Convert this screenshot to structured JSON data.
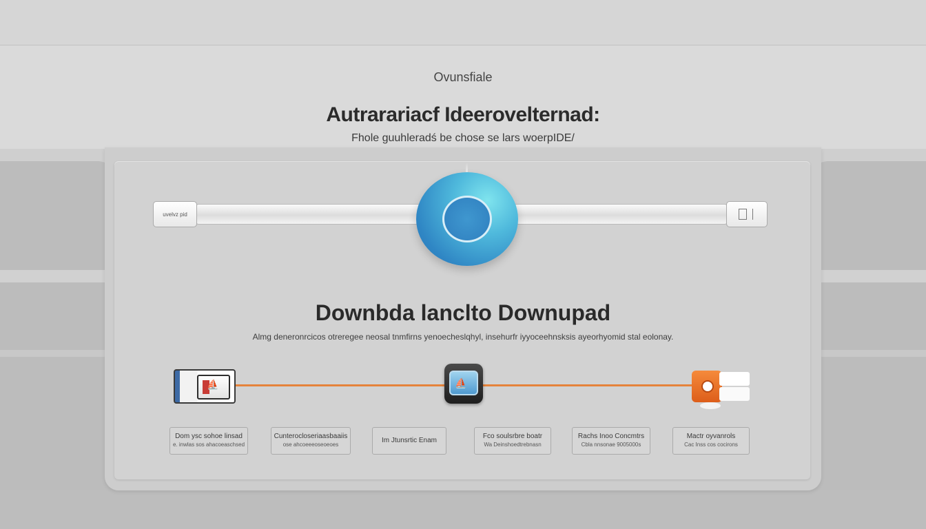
{
  "header": {
    "overline": "Ovunsfiale",
    "title": "Autrarariacf Ideerovelternad:",
    "subtitle": "Fhole guuhleradś be chose se lars woerpIDE/"
  },
  "slider": {
    "left_label": "uvelvz pid",
    "knob_icon": "circle-ring-icon"
  },
  "section": {
    "heading": "Downbda lanclto Downupad",
    "description": "Almg deneronrcicos otreregee neosal tnmfirns yenoecheslqhyl, insehurfr iyyoceehnsksis ayeorhyomid stal eolonay."
  },
  "timeline": {
    "line_color": "#e5823a",
    "nodes": [
      {
        "name": "document-gallery-node",
        "icon": "sailboat-icon"
      },
      {
        "name": "tablet-device-node",
        "icon": "tablet-screen-icon",
        "glyph": "⛵"
      },
      {
        "name": "orange-app-node",
        "icon": "orange-record-icon"
      }
    ]
  },
  "buttons": [
    {
      "line1": "Dom ysc sohoe linsad",
      "line2": "e. inwlas sos ahacoeaschsed"
    },
    {
      "line1": "Cunterocloseriaasbaaiis",
      "line2": "ose ahcoeeeoseoeoes"
    },
    {
      "line1": "Im Jtunsrtic Enam",
      "line2": ""
    },
    {
      "line1": "Fco soulsrbre boatr",
      "line2": "Wa Deinshoedtrebnasn"
    },
    {
      "line1": "Rachs Inoo Concmtrs",
      "line2": "Cbla nnsonae 9005000s"
    },
    {
      "line1": "Mactr oyvanrols",
      "line2": "Cac Inss cos cocirons"
    }
  ],
  "colors": {
    "accent_blue": "#2f86c4",
    "accent_cyan": "#7fe4ee",
    "accent_orange": "#e5823a"
  }
}
